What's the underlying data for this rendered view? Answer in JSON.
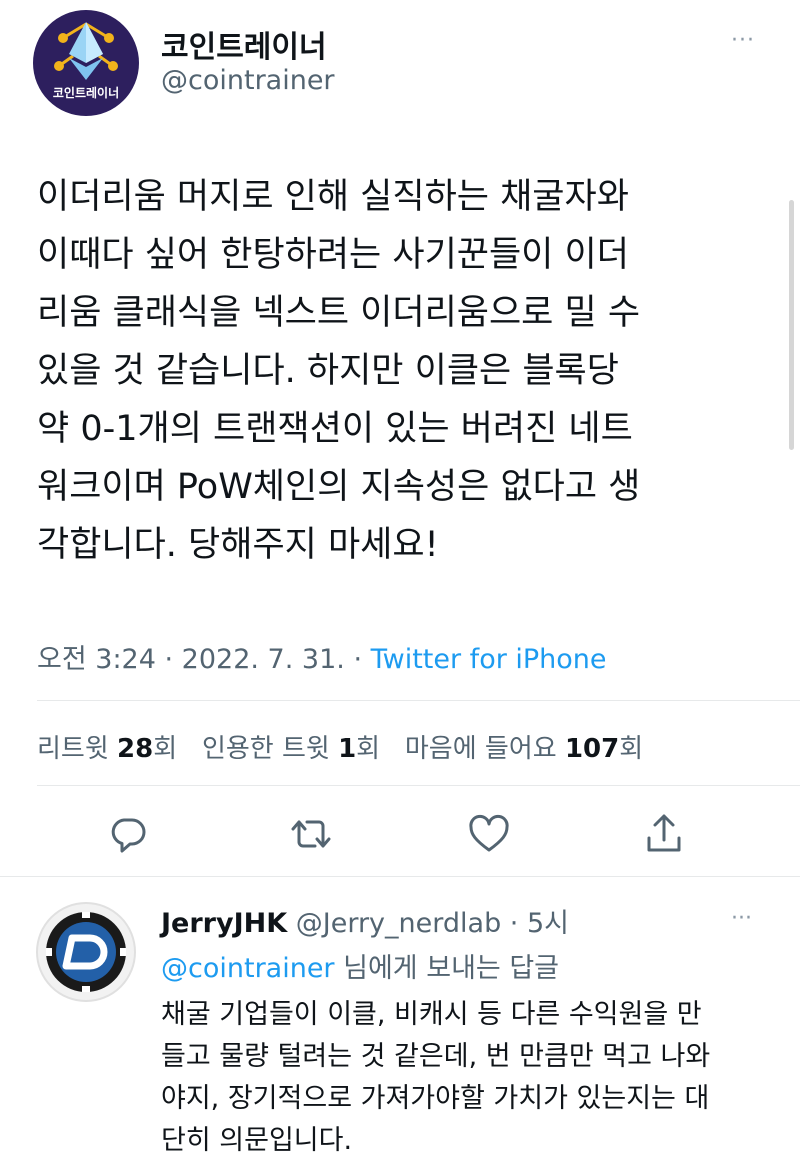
{
  "tweet": {
    "author_name": "코인트레이너",
    "author_handle": "@cointrainer",
    "avatar_logo_text": "코인트레이너",
    "text": "이더리움 머지로 인해 실직하는 채굴자와\n이때다 싶어 한탕하려는 사기꾼들이 이더\n리움 클래식을 넥스트 이더리움으로 밀 수\n있을 것 같습니다. 하지만 이클은 블록당\n약 0-1개의 트랜잭션이 있는 버려진 네트\n워크이며 PoW체인의 지속성은 없다고 생\n각합니다. 당해주지 마세요!",
    "time": "오전 3:24",
    "date": "2022. 7. 31.",
    "source": "Twitter for iPhone",
    "more_menu": "···"
  },
  "stats": {
    "retweets_label": "리트윗",
    "retweets_count": "28",
    "retweets_suffix": "회",
    "quotes_label": "인용한 트윗",
    "quotes_count": "1",
    "quotes_suffix": "회",
    "likes_label": "마음에 들어요",
    "likes_count": "107",
    "likes_suffix": "회"
  },
  "actions": [
    {
      "icon": "reply-icon"
    },
    {
      "icon": "retweet-icon"
    },
    {
      "icon": "like-icon"
    },
    {
      "icon": "share-icon"
    }
  ],
  "reply": {
    "author_name": "JerryJHK",
    "author_handle": "@Jerry_nerdlab",
    "time": "5시",
    "reply_to_mention": "@cointrainer",
    "reply_to_suffix": " 님에게 보내는 답글",
    "text": "채굴 기업들이 이클, 비캐시 등 다른 수익원을 만\n들고 물량 털려는 것 같은데, 번 만큼만 먹고 나와\n야지, 장기적으로 가져가야할 가치가 있는지는 대\n단히 의문입니다.",
    "more_menu": "···"
  },
  "colors": {
    "accent": "#1d9bf0",
    "secondary_text": "#536471",
    "avatar_bg": "#2d1f5e"
  }
}
